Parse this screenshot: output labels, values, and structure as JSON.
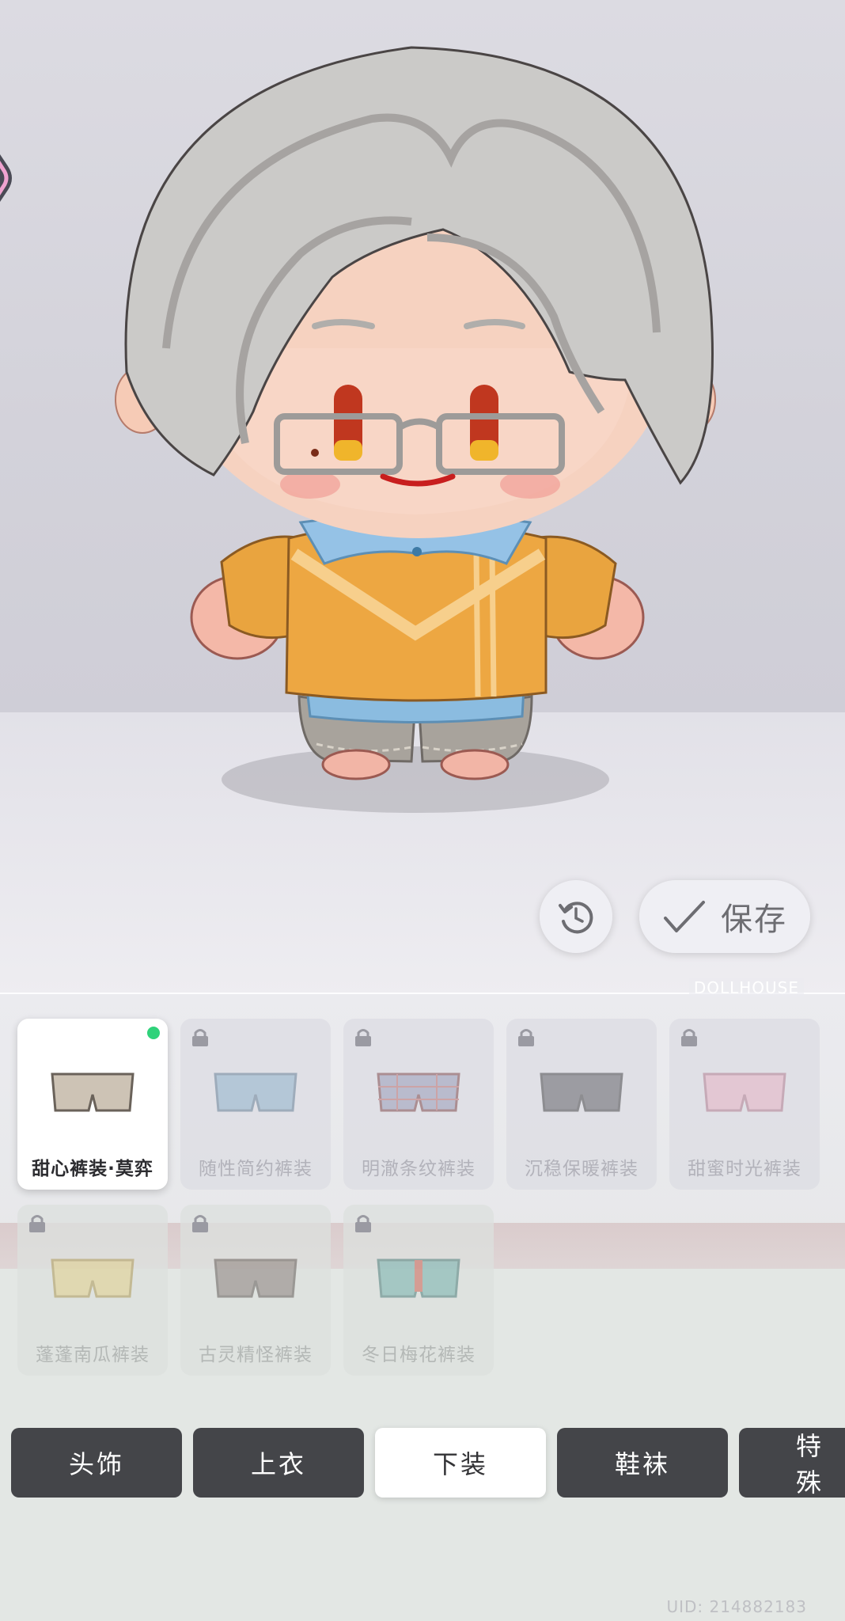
{
  "actions": {
    "reset_icon": "rotate-ccw-icon",
    "save_icon": "check-icon",
    "save_label": "保存"
  },
  "brand": "DOLLHOUSE",
  "items": [
    {
      "label": "甜心裤装·莫弈",
      "selected": true,
      "locked": false,
      "color": "#c9bfb0"
    },
    {
      "label": "随性简约裤装",
      "selected": false,
      "locked": true,
      "color": "#7fa9c6"
    },
    {
      "label": "明澈条纹裤装",
      "selected": false,
      "locked": true,
      "color": "#8a8fb0"
    },
    {
      "label": "沉稳保暖裤装",
      "selected": false,
      "locked": true,
      "color": "#4c4c50"
    },
    {
      "label": "甜蜜时光裤装",
      "selected": false,
      "locked": true,
      "color": "#e8a9be"
    },
    {
      "label": "蓬蓬南瓜裤装",
      "selected": false,
      "locked": true,
      "color": "#e3cc7a"
    },
    {
      "label": "古灵精怪裤装",
      "selected": false,
      "locked": true,
      "color": "#7a6d68"
    },
    {
      "label": "冬日梅花裤装",
      "selected": false,
      "locked": true,
      "color": "#5fa8a3"
    }
  ],
  "tabs": [
    {
      "label": "头饰",
      "active": false
    },
    {
      "label": "上衣",
      "active": false
    },
    {
      "label": "下装",
      "active": true
    },
    {
      "label": "鞋袜",
      "active": false
    },
    {
      "label": "特殊",
      "active": false
    }
  ],
  "uid": "UID: 214882183"
}
